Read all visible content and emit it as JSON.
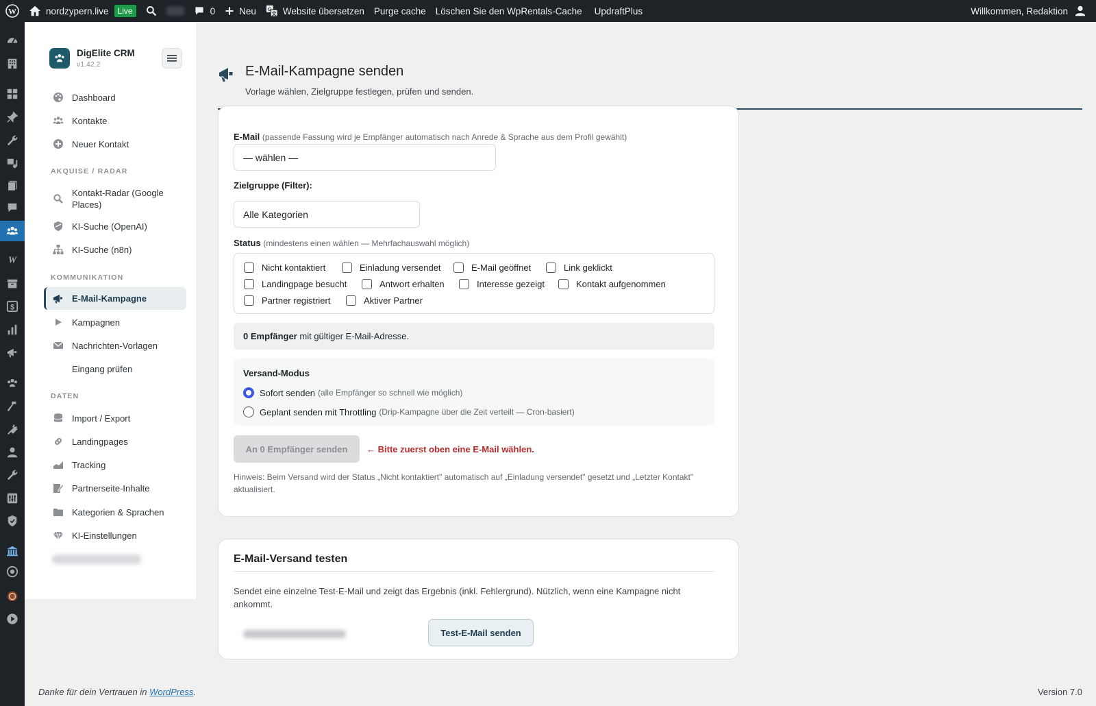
{
  "adminbar": {
    "site_name": "nordzypern.live",
    "live_badge": "Live",
    "comments_count": "0",
    "new_label": "Neu",
    "translate_label": "Website übersetzen",
    "purge_label": "Purge cache",
    "wprentals_label": "Löschen Sie den WpRentals-Cache",
    "updraft_label": "UpdraftPlus",
    "welcome": "Willkommen, Redaktion"
  },
  "sidebar": {
    "brand_name": "DigElite CRM",
    "brand_version": "v1.42.2",
    "sections": {
      "akquise": "Akquise / Radar",
      "kommunikation": "Kommunikation",
      "daten": "Daten"
    },
    "items": [
      {
        "label": "Dashboard",
        "icon": "palette-icon"
      },
      {
        "label": "Kontakte",
        "icon": "groups-icon"
      },
      {
        "label": "Neuer Kontakt",
        "icon": "plus-circle-icon"
      },
      {
        "label": "Kontakt-Radar (Google Places)",
        "icon": "search-icon"
      },
      {
        "label": "KI-Suche (OpenAI)",
        "icon": "shield-icon"
      },
      {
        "label": "KI-Suche (n8n)",
        "icon": "network-icon"
      },
      {
        "label": "E-Mail-Kampagne",
        "icon": "megaphone-icon"
      },
      {
        "label": "Kampagnen",
        "icon": "play-icon"
      },
      {
        "label": "Nachrichten-Vorlagen",
        "icon": "envelope-icon"
      },
      {
        "label": "Eingang prüfen",
        "icon": ""
      },
      {
        "label": "Import / Export",
        "icon": "database-icon"
      },
      {
        "label": "Landingpages",
        "icon": "link-icon"
      },
      {
        "label": "Tracking",
        "icon": "area-chart-icon"
      },
      {
        "label": "Partnerseite-Inhalte",
        "icon": "edit-page-icon"
      },
      {
        "label": "Kategorien & Sprachen",
        "icon": "folder-icon"
      },
      {
        "label": "KI-Einstellungen",
        "icon": "diamond-icon"
      }
    ]
  },
  "page": {
    "title": "E-Mail-Kampagne senden",
    "subtitle": "Vorlage wählen, Zielgruppe festlegen, prüfen und senden."
  },
  "form": {
    "email_label": "E-Mail",
    "email_hint": "(passende Fassung wird je Empfänger automatisch nach Anrede & Sprache aus dem Profil gewählt)",
    "email_select_value": "— wählen —",
    "zielgruppe_label": "Zielgruppe (Filter):",
    "zielgruppe_value": "Alle Kategorien",
    "status_label": "Status",
    "status_hint": "(mindestens einen wählen — Mehrfachauswahl möglich)",
    "statuses": [
      "Nicht kontaktiert",
      "Einladung versendet",
      "E-Mail geöffnet",
      "Link geklickt",
      "Landingpage besucht",
      "Antwort erhalten",
      "Interesse gezeigt",
      "Kontakt aufgenommen",
      "Partner registriert",
      "Aktiver Partner"
    ],
    "recipients_count": "0 Empfänger",
    "recipients_text": "mit gültiger E-Mail-Adresse.",
    "mode_title": "Versand-Modus",
    "mode_options": [
      {
        "label": "Sofort senden",
        "hint": "(alle Empfänger so schnell wie möglich)",
        "checked": true
      },
      {
        "label": "Geplant senden mit Throttling",
        "hint": "(Drip-Kampagne über die Zeit verteilt — Cron-basiert)",
        "checked": false
      }
    ],
    "send_button": "An 0 Empfänger senden",
    "warning": "← Bitte zuerst oben eine E-Mail wählen.",
    "note": "Hinweis: Beim Versand wird der Status „Nicht kontaktiert\" automatisch auf „Einladung versendet\" gesetzt und „Letzter Kontakt\" aktualisiert."
  },
  "test": {
    "title": "E-Mail-Versand testen",
    "description": "Sendet eine einzelne Test-E-Mail und zeigt das Ergebnis (inkl. Fehlergrund). Nützlich, wenn eine Kampagne nicht ankommt.",
    "button": "Test-E-Mail senden"
  },
  "footer": {
    "thanks_prefix": "Danke für dein Vertrauen in",
    "thanks_link": "WordPress",
    "thanks_suffix": ".",
    "version": "Version 7.0"
  },
  "colors": {
    "admin_bar": "#1d2327",
    "accent": "#2c4a5e",
    "active_menu": "#2271b1",
    "warning": "#b32d2e",
    "radio": "#3858e9"
  }
}
